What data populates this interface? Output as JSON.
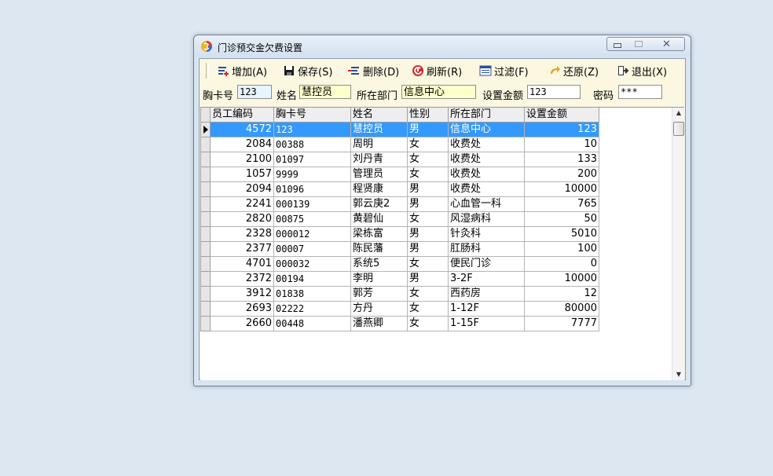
{
  "window": {
    "title": "门诊预交金欠费设置"
  },
  "toolbar": {
    "add": "增加(A)",
    "save": "保存(S)",
    "delete": "删除(D)",
    "refresh": "刷新(R)",
    "filter": "过滤(F)",
    "restore": "还原(Z)",
    "exit": "退出(X)"
  },
  "form": {
    "card_label": "胸卡号",
    "card_value": "123",
    "name_label": "姓名",
    "name_value": "慧控员",
    "dept_label": "所在部门",
    "dept_value": "信息中心",
    "amount_label": "设置金额",
    "amount_value": "123",
    "password_label": "密码",
    "password_value": "***"
  },
  "table": {
    "headers": [
      "员工编码",
      "胸卡号",
      "姓名",
      "性别",
      "所在部门",
      "设置金额"
    ],
    "rows": [
      [
        "4572",
        "123",
        "慧控员",
        "男",
        "信息中心",
        "123"
      ],
      [
        "2084",
        "00388",
        "周明",
        "女",
        "收费处",
        "10"
      ],
      [
        "2100",
        "01097",
        "刘丹青",
        "女",
        "收费处",
        "133"
      ],
      [
        "1057",
        "9999",
        "管理员",
        "女",
        "收费处",
        "200"
      ],
      [
        "2094",
        "01096",
        "程贤康",
        "男",
        "收费处",
        "10000"
      ],
      [
        "2241",
        "000139",
        "郭云庚2",
        "男",
        "心血管一科",
        "765"
      ],
      [
        "2820",
        "00875",
        "黄碧仙",
        "女",
        "风湿病科",
        "50"
      ],
      [
        "2328",
        "000012",
        "梁栋富",
        "男",
        "针灸科",
        "5010"
      ],
      [
        "2377",
        "00007",
        "陈民藩",
        "男",
        "肛肠科",
        "100"
      ],
      [
        "4701",
        "000032",
        "系统5",
        "女",
        "便民门诊",
        "0"
      ],
      [
        "2372",
        "00194",
        "李明",
        "男",
        "3-2F",
        "10000"
      ],
      [
        "3912",
        "01838",
        "郭芳",
        "女",
        "西药房",
        "12"
      ],
      [
        "2693",
        "02222",
        "方丹",
        "女",
        "1-12F",
        "80000"
      ],
      [
        "2660",
        "00448",
        "潘燕卿",
        "女",
        "1-15F",
        "7777"
      ]
    ],
    "selected_row": 0
  },
  "colors": {
    "selection": "#3399ff",
    "client_bg": "#fbf7e0",
    "field_highlight": "#ffffcc",
    "field_card": "#e8f4ff"
  }
}
